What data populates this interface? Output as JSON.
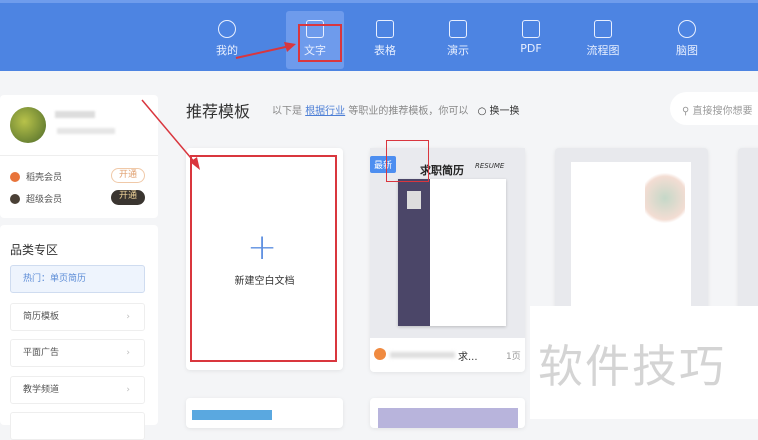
{
  "nav": [
    {
      "label": "我的",
      "icon": "star-icon"
    },
    {
      "label": "文字",
      "icon": "document-icon"
    },
    {
      "label": "表格",
      "icon": "table-icon"
    },
    {
      "label": "演示",
      "icon": "presentation-icon"
    },
    {
      "label": "PDF",
      "icon": "pdf-icon"
    },
    {
      "label": "流程图",
      "icon": "flowchart-icon"
    },
    {
      "label": "脑图",
      "icon": "mindmap-icon"
    }
  ],
  "user": {
    "members": [
      {
        "label": "稻壳会员",
        "button": "开通",
        "color": "#e8743b"
      },
      {
        "label": "超级会员",
        "button": "开通",
        "color": "#4a4036"
      }
    ]
  },
  "categories": {
    "title": "品类专区",
    "hot": "热门：单页简历",
    "items": [
      "简历模板",
      "平面广告",
      "教学频道"
    ]
  },
  "main": {
    "title": "推荐模板",
    "subtitle_pre": "以下是",
    "subtitle_link": "根据行业",
    "subtitle_post": "等职业的推荐模板，你可以",
    "refresh": "换一换",
    "search_placeholder": "直接搜你想要"
  },
  "templates": {
    "blank": "新建空白文档",
    "badge": "最新",
    "resume_title": "求职简历",
    "resume_sub": "RESUME",
    "name_suffix": "求...",
    "pages": "1页"
  },
  "watermark": "软件技巧"
}
